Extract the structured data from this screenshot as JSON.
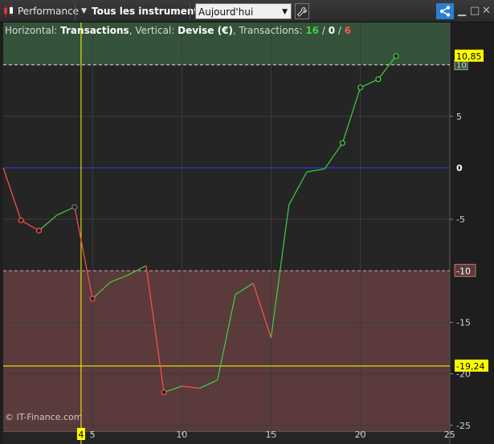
{
  "toolbar": {
    "indicator_label": "Performance",
    "instruments_label": "Tous les instruments",
    "period_selected": "Aujourd'hui",
    "icons": [
      "candlestick-icon",
      "dropdown-icon",
      "wrench-icon",
      "share-icon",
      "minimize-icon",
      "maximize-icon",
      "close-icon"
    ]
  },
  "info": {
    "horizontal_prefix": "Horizontal: ",
    "horizontal_value": "Transactions",
    "vertical_prefix": ", Vertical: ",
    "vertical_value": "Devise (€)",
    "transactions_prefix": ", Transactions: ",
    "tx_winning": "16",
    "tx_sep1": " / ",
    "tx_neutral": "0",
    "tx_sep2": " / ",
    "tx_losing": "6"
  },
  "copyright": "© IT-Finance.com",
  "colors": {
    "gain": "#3fd13f",
    "loss": "#ff5050",
    "zero_line": "#2a3bff",
    "cursor": "#ffff00",
    "upper_zone": "#35523a",
    "lower_zone": "#5a3a3a"
  },
  "chart_data": {
    "type": "line",
    "x": [
      0,
      1,
      2,
      3,
      4,
      5,
      6,
      7,
      8,
      9,
      10,
      11,
      12,
      13,
      14,
      15,
      16,
      17,
      18,
      19,
      20,
      21,
      22
    ],
    "y": [
      0,
      -5.1,
      -6.1,
      -4.6,
      -3.8,
      -12.7,
      -11.1,
      -10.4,
      -9.5,
      -21.8,
      -21.2,
      -21.4,
      -20.6,
      -12.3,
      -11.2,
      -16.5,
      -3.6,
      -0.4,
      -0.1,
      2.4,
      7.8,
      8.6,
      10.85
    ],
    "markers_x": [
      1,
      2,
      4,
      5,
      9,
      19,
      20,
      21,
      22
    ],
    "xlim": [
      0,
      25
    ],
    "ylim": [
      -25,
      14.5
    ],
    "xticks": [
      "5",
      "10",
      "15",
      "20",
      "25"
    ],
    "xtick_values": [
      5,
      10,
      15,
      20,
      25
    ],
    "yticks": [
      "-25",
      "-20",
      "-15",
      "-10",
      "-5",
      "0",
      "5",
      "10"
    ],
    "ytick_values": [
      -25,
      -20,
      -15,
      -10,
      -5,
      0,
      5,
      10
    ],
    "upper_level": 10,
    "upper_level_label": "10",
    "last_value_label": "10,85",
    "last_value": 10.85,
    "lower_level": -10,
    "lower_level_label": "-10",
    "cursor_y": -19.24,
    "cursor_y_label": "-19,24",
    "cursor_x": 4,
    "cursor_x_label": "4",
    "zero_label": "0",
    "grid": true
  }
}
